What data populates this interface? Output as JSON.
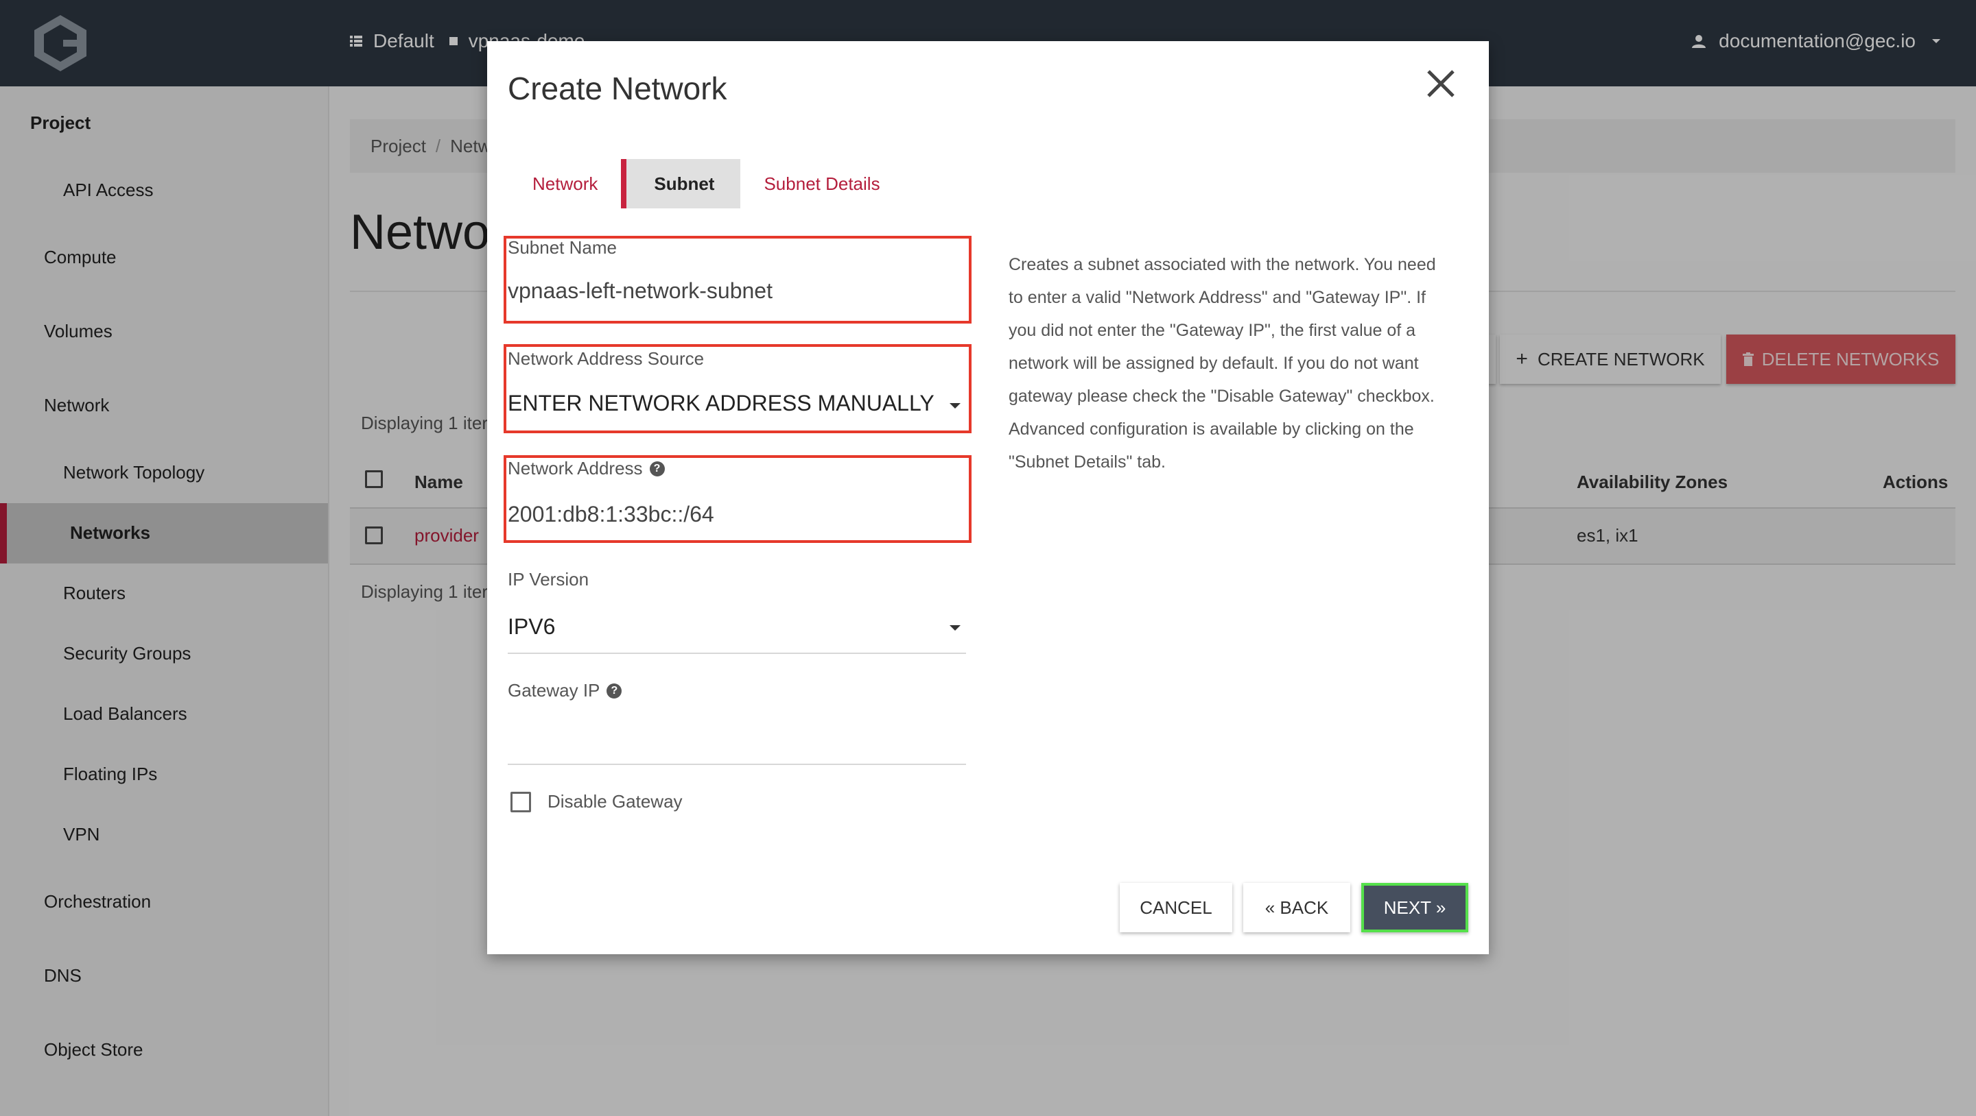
{
  "topbar": {
    "project_domain": "Default",
    "project_name": "vpnaas-demo",
    "user": "documentation@gec.io"
  },
  "sidebar": {
    "project_label": "Project",
    "items": [
      {
        "label": "API Access"
      },
      {
        "label": "Compute"
      },
      {
        "label": "Volumes"
      },
      {
        "label": "Network"
      },
      {
        "label": "Network Topology"
      },
      {
        "label": "Networks"
      },
      {
        "label": "Routers"
      },
      {
        "label": "Security Groups"
      },
      {
        "label": "Load Balancers"
      },
      {
        "label": "Floating IPs"
      },
      {
        "label": "VPN"
      },
      {
        "label": "Orchestration"
      },
      {
        "label": "DNS"
      },
      {
        "label": "Object Store"
      }
    ]
  },
  "main": {
    "breadcrumb": [
      "Project",
      "/",
      "Netw"
    ],
    "title": "Netwo",
    "create_label": "CREATE NETWORK",
    "delete_label": "DELETE NETWORKS",
    "displaying": "Displaying 1 iter",
    "table": {
      "columns": [
        "Name",
        "Availability Zones",
        "Actions"
      ],
      "rows": [
        {
          "name": "provider",
          "zones": "es1, ix1"
        }
      ]
    }
  },
  "modal": {
    "title": "Create Network",
    "tabs": [
      "Network",
      "Subnet",
      "Subnet Details"
    ],
    "active_tab": "Subnet",
    "fields": {
      "subnet_name": {
        "label": "Subnet Name",
        "value": "vpnaas-left-network-subnet"
      },
      "address_source": {
        "label": "Network Address Source",
        "value": "ENTER NETWORK ADDRESS MANUALLY"
      },
      "network_address": {
        "label": "Network Address",
        "value": "2001:db8:1:33bc::/64"
      },
      "ip_version": {
        "label": "IP Version",
        "value": "IPV6"
      },
      "gateway_ip": {
        "label": "Gateway IP",
        "value": ""
      }
    },
    "disable_gateway_label": "Disable Gateway",
    "description": "Creates a subnet associated with the network. You need to enter a valid \"Network Address\" and \"Gateway IP\". If you did not enter the \"Gateway IP\", the first value of a network will be assigned by default. If you do not want gateway please check the \"Disable Gateway\" checkbox. Advanced configuration is available by clicking on the \"Subnet Details\" tab.",
    "buttons": {
      "cancel": "CANCEL",
      "back": "« BACK",
      "next": "NEXT »"
    }
  },
  "colors": {
    "topbar": "#2e3742",
    "accent": "#b41e3c",
    "highlight_box": "#e6392b",
    "next_highlight": "#55e04b",
    "delete_button": "#d5585e"
  },
  "icons": [
    "logo-icon",
    "list-icon",
    "square-icon",
    "user-icon",
    "caret-down-icon",
    "close-icon",
    "plus-icon",
    "trash-icon",
    "help-icon",
    "checkbox-icon"
  ]
}
